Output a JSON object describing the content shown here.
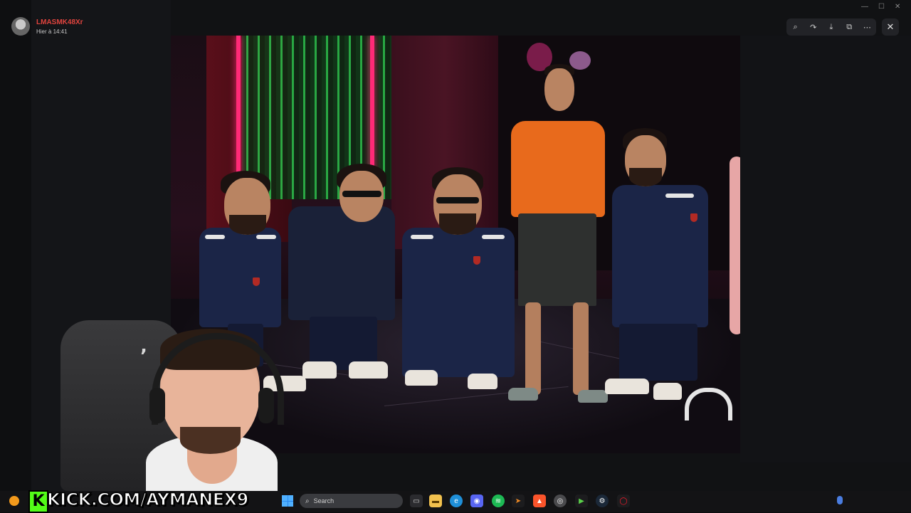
{
  "message": {
    "author": "LMASMK48Xr",
    "timestamp": "Hier à 14:41"
  },
  "viewer_toolbar": {
    "zoom_icon": "zoom-icon",
    "forward_icon": "forward-icon",
    "download_icon": "download-icon",
    "open_external_icon": "open-external-icon",
    "more_icon": "more-icon",
    "close_icon": "close-icon"
  },
  "taskbar": {
    "search_placeholder": "Search",
    "apps": [
      "file-explorer",
      "folder",
      "edge",
      "discord",
      "spotify",
      "arrow-app",
      "brave",
      "chrome",
      "game",
      "steam",
      "opera"
    ]
  },
  "stream_overlay": {
    "kick_logo": "K",
    "kick_url": "KICK.COM/AYMANEX9"
  },
  "colors": {
    "author": "#e0443e",
    "kick_green": "#53fc18"
  }
}
